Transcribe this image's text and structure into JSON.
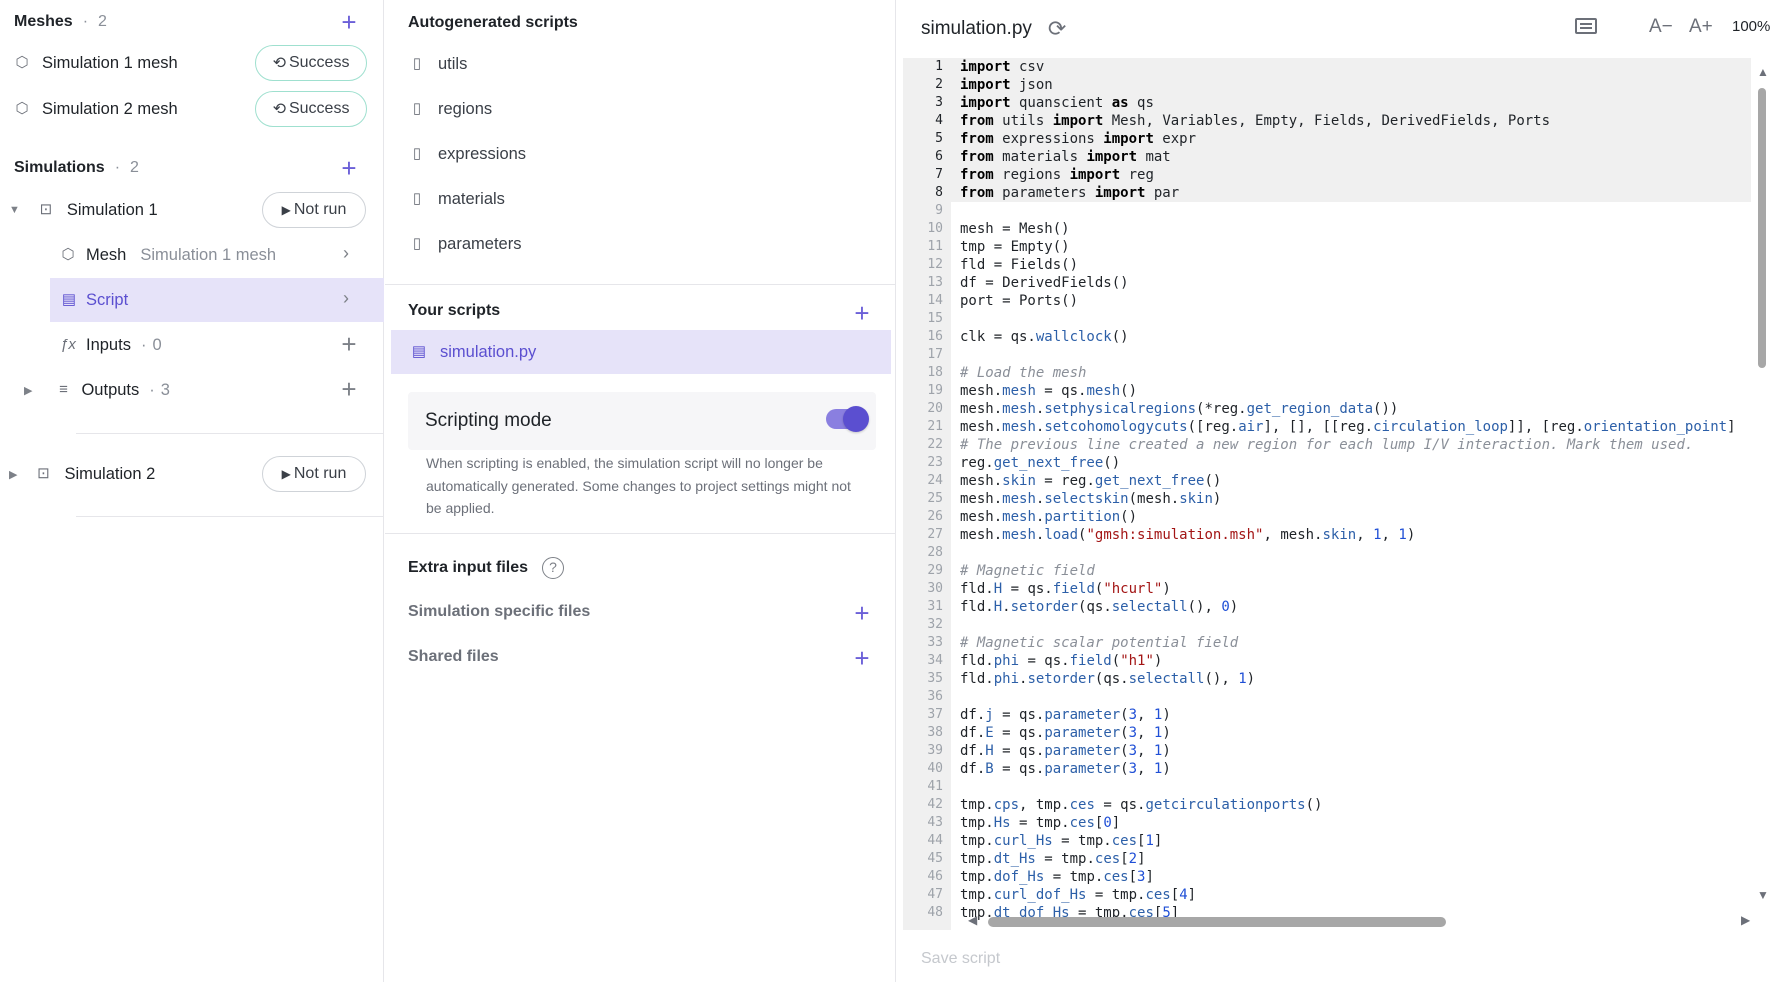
{
  "meshes": {
    "title": "Meshes",
    "count": "2",
    "items": [
      {
        "label": "Simulation 1 mesh",
        "status": "Success"
      },
      {
        "label": "Simulation 2 mesh",
        "status": "Success"
      }
    ]
  },
  "simulations": {
    "title": "Simulations",
    "count": "2",
    "sim1": {
      "label": "Simulation 1",
      "status": "Not run",
      "mesh_label": "Mesh",
      "mesh_value": "Simulation 1 mesh",
      "script_label": "Script",
      "inputs_label": "Inputs",
      "inputs_count": "0",
      "outputs_label": "Outputs",
      "outputs_count": "3"
    },
    "sim2": {
      "label": "Simulation 2",
      "status": "Not run"
    }
  },
  "middle": {
    "autogen_title": "Autogenerated scripts",
    "autogen_items": [
      "utils",
      "regions",
      "expressions",
      "materials",
      "parameters"
    ],
    "your_scripts_title": "Your scripts",
    "your_scripts": [
      "simulation.py"
    ],
    "scripting_mode_label": "Scripting mode",
    "scripting_mode_on": true,
    "scripting_mode_desc": "When scripting is enabled, the simulation script will no longer be automatically generated. Some changes to project settings might not be applied.",
    "extra_input_title": "Extra input files",
    "sim_specific_files": "Simulation specific files",
    "shared_files": "Shared files"
  },
  "editor": {
    "filename": "simulation.py",
    "zoom": "100%",
    "font_decrease": "A−",
    "font_increase": "A+",
    "save_label": "Save script",
    "code_lines": [
      "import csv",
      "import json",
      "import quanscient as qs",
      "from utils import Mesh, Variables, Empty, Fields, DerivedFields, Ports",
      "from expressions import expr",
      "from materials import mat",
      "from regions import reg",
      "from parameters import par",
      "",
      "mesh = Mesh()",
      "tmp = Empty()",
      "fld = Fields()",
      "df = DerivedFields()",
      "port = Ports()",
      "",
      "clk = qs.wallclock()",
      "",
      "# Load the mesh",
      "mesh.mesh = qs.mesh()",
      "mesh.mesh.setphysicalregions(*reg.get_region_data())",
      "mesh.mesh.setcohomologycuts([reg.air], [], [[reg.circulation_loop]], [reg.orientation_point]",
      "# The previous line created a new region for each lump I/V interaction. Mark them used.",
      "reg.get_next_free()",
      "mesh.skin = reg.get_next_free()",
      "mesh.mesh.selectskin(mesh.skin)",
      "mesh.mesh.partition()",
      "mesh.mesh.load(\"gmsh:simulation.msh\", mesh.skin, 1, 1)",
      "",
      "# Magnetic field",
      "fld.H = qs.field(\"hcurl\")",
      "fld.H.setorder(qs.selectall(), 0)",
      "",
      "# Magnetic scalar potential field",
      "fld.phi = qs.field(\"h1\")",
      "fld.phi.setorder(qs.selectall(), 1)",
      "",
      "df.j = qs.parameter(3, 1)",
      "df.E = qs.parameter(3, 1)",
      "df.H = qs.parameter(3, 1)",
      "df.B = qs.parameter(3, 1)",
      "",
      "tmp.cps, tmp.ces = qs.getcirculationports()",
      "tmp.Hs = tmp.ces[0]",
      "tmp.curl_Hs = tmp.ces[1]",
      "tmp.dt_Hs = tmp.ces[2]",
      "tmp.dof_Hs = tmp.ces[3]",
      "tmp.curl_dof_Hs = tmp.ces[4]",
      "tmp.dt_dof_Hs = tmp.ces[5]"
    ]
  }
}
